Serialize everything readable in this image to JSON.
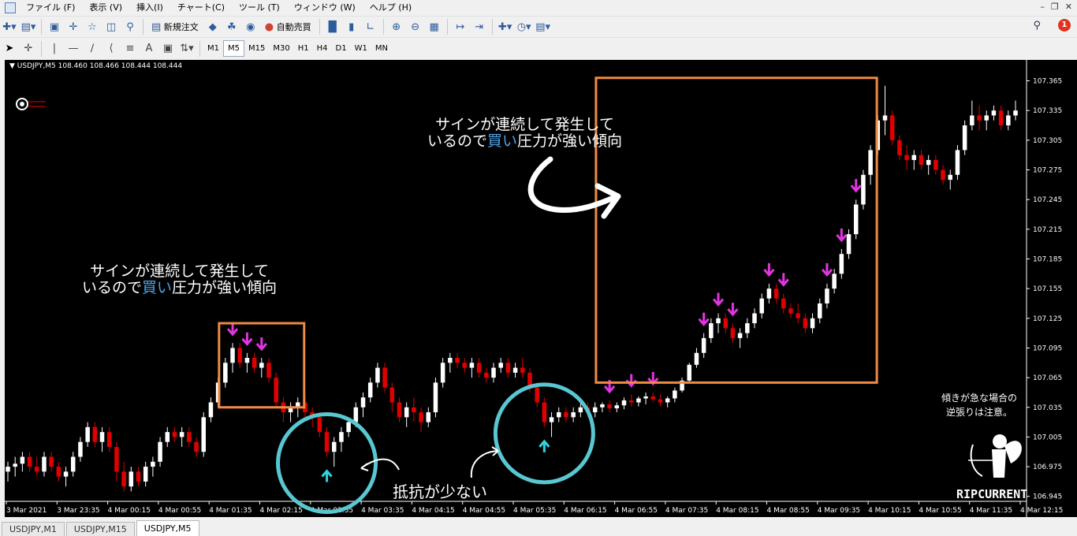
{
  "menu": {
    "items": [
      "ファイル (F)",
      "表示 (V)",
      "挿入(I)",
      "チャート(C)",
      "ツール (T)",
      "ウィンドウ (W)",
      "ヘルプ (H)"
    ]
  },
  "toolbar": {
    "new_order_label": "新規注文",
    "auto_trade_label": "自動売買",
    "notification_count": "1"
  },
  "timeframes": [
    "M1",
    "M5",
    "M15",
    "M30",
    "H1",
    "H4",
    "D1",
    "W1",
    "MN"
  ],
  "active_timeframe": "M5",
  "chart": {
    "symbol_info": "USDJPY,M5  108.460 108.466 108.444 108.444",
    "price_labels": [
      "107.365",
      "107.335",
      "107.305",
      "107.275",
      "107.245",
      "107.215",
      "107.185",
      "107.155",
      "107.125",
      "107.095",
      "107.065",
      "107.035",
      "107.005",
      "106.975",
      "106.945"
    ],
    "time_labels": [
      "3 Mar 2021",
      "3 Mar 23:35",
      "4 Mar 00:15",
      "4 Mar 00:55",
      "4 Mar 01:35",
      "4 Mar 02:15",
      "4 Mar 02:55",
      "4 Mar 03:35",
      "4 Mar 04:15",
      "4 Mar 04:55",
      "4 Mar 05:35",
      "4 Mar 06:15",
      "4 Mar 06:55",
      "4 Mar 07:35",
      "4 Mar 08:15",
      "4 Mar 08:55",
      "4 Mar 09:35",
      "4 Mar 10:15",
      "4 Mar 10:55",
      "4 Mar 11:35",
      "4 Mar 12:15"
    ],
    "bull_color": "#ffffff",
    "bear_color": "#e00000",
    "signal_down_color": "#e234e2",
    "signal_up_color": "#2fd3e0",
    "highlight_box_color": "#f08a44",
    "circle_color": "#58c7d1"
  },
  "chart_data": {
    "type": "candlestick",
    "series": [
      {
        "ohlc": [
          [
            106.97,
            106.98,
            106.96,
            106.975
          ],
          [
            106.975,
            106.985,
            106.965,
            106.978
          ],
          [
            106.978,
            106.99,
            106.97,
            106.985
          ],
          [
            106.985,
            106.99,
            106.97,
            106.975
          ],
          [
            106.975,
            106.985,
            106.965,
            106.97
          ],
          [
            106.97,
            106.99,
            106.965,
            106.985
          ],
          [
            106.985,
            106.99,
            106.97,
            106.975
          ],
          [
            106.975,
            106.98,
            106.96,
            106.965
          ],
          [
            106.965,
            106.975,
            106.955,
            106.97
          ],
          [
            106.97,
            106.99,
            106.965,
            106.985
          ],
          [
            106.985,
            107.005,
            106.98,
            107.0
          ],
          [
            107.0,
            107.02,
            106.995,
            107.015
          ],
          [
            107.015,
            107.02,
            106.995,
            107.0
          ],
          [
            107.0,
            107.015,
            106.99,
            107.01
          ],
          [
            107.01,
            107.015,
            106.99,
            106.995
          ],
          [
            106.995,
            107.0,
            106.96,
            106.97
          ],
          [
            106.97,
            106.98,
            106.95,
            106.955
          ],
          [
            106.955,
            106.975,
            106.95,
            106.97
          ],
          [
            106.97,
            106.975,
            106.955,
            106.96
          ],
          [
            106.96,
            106.98,
            106.955,
            106.975
          ],
          [
            106.975,
            106.985,
            106.965,
            106.98
          ],
          [
            106.98,
            107.005,
            106.975,
            107.0
          ],
          [
            107.0,
            107.015,
            106.995,
            107.01
          ],
          [
            107.01,
            107.015,
            107.0,
            107.005
          ],
          [
            107.005,
            107.015,
            106.995,
            107.01
          ],
          [
            107.01,
            107.015,
            106.995,
            107.0
          ],
          [
            107.0,
            107.005,
            106.985,
            106.99
          ],
          [
            106.99,
            107.03,
            106.985,
            107.025
          ],
          [
            107.025,
            107.045,
            107.02,
            107.04
          ],
          [
            107.04,
            107.065,
            107.035,
            107.06
          ],
          [
            107.06,
            107.085,
            107.055,
            107.08
          ],
          [
            107.08,
            107.1,
            107.07,
            107.095
          ],
          [
            107.095,
            107.1,
            107.075,
            107.08
          ],
          [
            107.08,
            107.09,
            107.07,
            107.085
          ],
          [
            107.085,
            107.09,
            107.07,
            107.075
          ],
          [
            107.075,
            107.085,
            107.065,
            107.08
          ],
          [
            107.08,
            107.085,
            107.06,
            107.065
          ],
          [
            107.065,
            107.07,
            107.035,
            107.04
          ],
          [
            107.04,
            107.045,
            107.02,
            107.03
          ],
          [
            107.03,
            107.04,
            107.02,
            107.035
          ],
          [
            107.035,
            107.045,
            107.025,
            107.04
          ],
          [
            107.04,
            107.045,
            107.025,
            107.03
          ],
          [
            107.03,
            107.035,
            107.015,
            107.025
          ],
          [
            107.025,
            107.03,
            107.005,
            107.01
          ],
          [
            107.01,
            107.015,
            106.985,
            106.99
          ],
          [
            106.99,
            107.005,
            106.975,
            107.0
          ],
          [
            107.0,
            107.015,
            106.99,
            107.01
          ],
          [
            107.01,
            107.025,
            107.005,
            107.02
          ],
          [
            107.02,
            107.04,
            107.015,
            107.035
          ],
          [
            107.035,
            107.05,
            107.025,
            107.045
          ],
          [
            107.045,
            107.065,
            107.04,
            107.06
          ],
          [
            107.06,
            107.08,
            107.055,
            107.075
          ],
          [
            107.075,
            107.08,
            107.05,
            107.055
          ],
          [
            107.055,
            107.06,
            107.03,
            107.04
          ],
          [
            107.04,
            107.045,
            107.02,
            107.025
          ],
          [
            107.025,
            107.04,
            107.015,
            107.035
          ],
          [
            107.035,
            107.045,
            107.02,
            107.03
          ],
          [
            107.03,
            107.035,
            107.01,
            107.02
          ],
          [
            107.02,
            107.035,
            107.015,
            107.03
          ],
          [
            107.03,
            107.065,
            107.025,
            107.06
          ],
          [
            107.06,
            107.085,
            107.055,
            107.08
          ],
          [
            107.08,
            107.09,
            107.07,
            107.085
          ],
          [
            107.085,
            107.09,
            107.075,
            107.08
          ],
          [
            107.08,
            107.085,
            107.07,
            107.075
          ],
          [
            107.075,
            107.085,
            107.065,
            107.08
          ],
          [
            107.08,
            107.085,
            107.065,
            107.07
          ],
          [
            107.07,
            107.075,
            107.06,
            107.065
          ],
          [
            107.065,
            107.08,
            107.06,
            107.075
          ],
          [
            107.075,
            107.085,
            107.07,
            107.08
          ],
          [
            107.08,
            107.085,
            107.065,
            107.07
          ],
          [
            107.07,
            107.08,
            107.065,
            107.075
          ],
          [
            107.075,
            107.085,
            107.065,
            107.07
          ],
          [
            107.07,
            107.075,
            107.05,
            107.055
          ],
          [
            107.055,
            107.06,
            107.035,
            107.04
          ],
          [
            107.04,
            107.045,
            107.015,
            107.02
          ],
          [
            107.02,
            107.03,
            107.005,
            107.025
          ],
          [
            107.025,
            107.035,
            107.02,
            107.03
          ],
          [
            107.03,
            107.035,
            107.02,
            107.025
          ],
          [
            107.025,
            107.035,
            107.02,
            107.03
          ],
          [
            107.03,
            107.04,
            107.025,
            107.035
          ],
          [
            107.035,
            107.04,
            107.025,
            107.03
          ],
          [
            107.03,
            107.04,
            107.025,
            107.035
          ],
          [
            107.035,
            107.04,
            107.03,
            107.038
          ],
          [
            107.038,
            107.042,
            107.03,
            107.034
          ],
          [
            107.034,
            107.04,
            107.03,
            107.037
          ],
          [
            107.037,
            107.045,
            107.033,
            107.042
          ],
          [
            107.042,
            107.048,
            107.036,
            107.04
          ],
          [
            107.04,
            107.046,
            107.036,
            107.044
          ],
          [
            107.044,
            107.05,
            107.038,
            107.046
          ],
          [
            107.046,
            107.05,
            107.04,
            107.043
          ],
          [
            107.043,
            107.048,
            107.036,
            107.04
          ],
          [
            107.04,
            107.046,
            107.035,
            107.044
          ],
          [
            107.044,
            107.055,
            107.04,
            107.052
          ],
          [
            107.052,
            107.065,
            107.05,
            107.062
          ],
          [
            107.062,
            107.08,
            107.06,
            107.078
          ],
          [
            107.078,
            107.095,
            107.075,
            107.09
          ],
          [
            107.09,
            107.11,
            107.085,
            107.105
          ],
          [
            107.105,
            107.125,
            107.1,
            107.12
          ],
          [
            107.12,
            107.13,
            107.11,
            107.125
          ],
          [
            107.125,
            107.13,
            107.11,
            107.115
          ],
          [
            107.115,
            107.12,
            107.1,
            107.105
          ],
          [
            107.105,
            107.115,
            107.095,
            107.11
          ],
          [
            107.11,
            107.125,
            107.105,
            107.12
          ],
          [
            107.12,
            107.135,
            107.115,
            107.13
          ],
          [
            107.13,
            107.15,
            107.125,
            107.145
          ],
          [
            107.145,
            107.16,
            107.14,
            107.155
          ],
          [
            107.155,
            107.16,
            107.14,
            107.145
          ],
          [
            107.145,
            107.15,
            107.13,
            107.135
          ],
          [
            107.135,
            107.14,
            107.125,
            107.13
          ],
          [
            107.13,
            107.14,
            107.12,
            107.125
          ],
          [
            107.125,
            107.13,
            107.11,
            107.115
          ],
          [
            107.115,
            107.13,
            107.11,
            107.125
          ],
          [
            107.125,
            107.145,
            107.12,
            107.14
          ],
          [
            107.14,
            107.16,
            107.135,
            107.155
          ],
          [
            107.155,
            107.175,
            107.15,
            107.17
          ],
          [
            107.17,
            107.195,
            107.165,
            107.19
          ],
          [
            107.19,
            107.215,
            107.185,
            107.21
          ],
          [
            107.21,
            107.245,
            107.205,
            107.24
          ],
          [
            107.24,
            107.275,
            107.235,
            107.27
          ],
          [
            107.27,
            107.3,
            107.26,
            107.295
          ],
          [
            107.295,
            107.33,
            107.29,
            107.325
          ],
          [
            107.325,
            107.36,
            107.31,
            107.33
          ],
          [
            107.33,
            107.335,
            107.3,
            107.305
          ],
          [
            107.305,
            107.31,
            107.285,
            107.29
          ],
          [
            107.29,
            107.3,
            107.275,
            107.285
          ],
          [
            107.285,
            107.295,
            107.275,
            107.29
          ],
          [
            107.29,
            107.295,
            107.275,
            107.28
          ],
          [
            107.28,
            107.29,
            107.27,
            107.285
          ],
          [
            107.285,
            107.29,
            107.27,
            107.275
          ],
          [
            107.275,
            107.28,
            107.26,
            107.265
          ],
          [
            107.265,
            107.275,
            107.255,
            107.27
          ],
          [
            107.27,
            107.3,
            107.265,
            107.295
          ],
          [
            107.295,
            107.325,
            107.29,
            107.32
          ],
          [
            107.32,
            107.345,
            107.315,
            107.33
          ],
          [
            107.33,
            107.34,
            107.315,
            107.325
          ],
          [
            107.325,
            107.335,
            107.315,
            107.33
          ],
          [
            107.33,
            107.34,
            107.325,
            107.335
          ],
          [
            107.335,
            107.34,
            107.315,
            107.32
          ],
          [
            107.32,
            107.335,
            107.315,
            107.33
          ],
          [
            107.33,
            107.345,
            107.325,
            107.335
          ]
        ],
        "down_signals": [
          31,
          33,
          35,
          83,
          86,
          89,
          96,
          98,
          100,
          105,
          107,
          113,
          115,
          117
        ],
        "up_signals": [
          44,
          74
        ]
      }
    ],
    "xlabel": "",
    "ylabel": "",
    "ylim": [
      106.94,
      107.375
    ]
  },
  "annotations": {
    "box1_line1": "サインが連続して発生して",
    "box1_line2_pre": "いるので",
    "box1_line2_hl": "買い",
    "box1_line2_post": "圧力が強い傾向",
    "box2_line1": "サインが連続して発生して",
    "box2_line2_pre": "いるので",
    "box2_line2_hl": "買い",
    "box2_line2_post": "圧力が強い傾向",
    "resistance": "抵抗が少ない",
    "note_line1": "傾きが急な場合の",
    "note_line2": "逆張りは注意。",
    "logo": "RIPCURRENT"
  },
  "tabs": [
    "USDJPY,M1",
    "USDJPY,M15",
    "USDJPY,M5"
  ],
  "active_tab": "USDJPY,M5"
}
